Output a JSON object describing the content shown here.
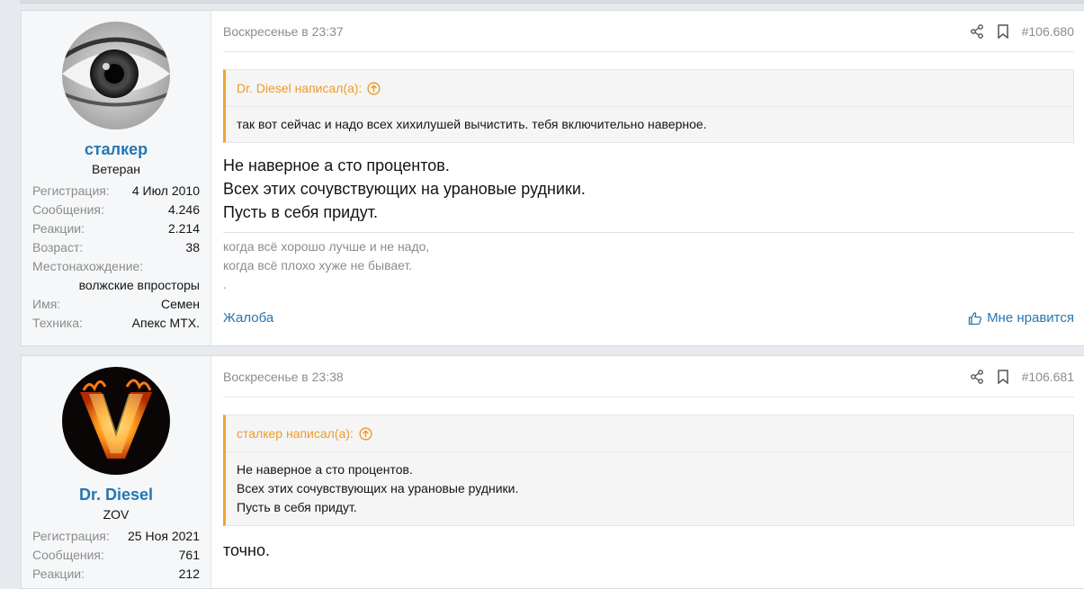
{
  "posts": [
    {
      "user": {
        "name": "сталкер",
        "title": "Ветеран",
        "avatar": "eye-avatar"
      },
      "stats": {
        "reg_label": "Регистрация:",
        "reg": "4 Июл 2010",
        "msg_label": "Сообщения:",
        "msgs": "4.246",
        "react_label": "Реакции:",
        "reacts": "2.214",
        "age_label": "Возраст:",
        "age": "38",
        "loc_label": "Местонахождение:",
        "loc": "волжские впросторы",
        "name_label": "Имя:",
        "real_name": "Семен",
        "tech_label": "Техника:",
        "tech": "Апекс МТХ."
      },
      "time": "Воскресенье в 23:37",
      "number": "#106.680",
      "quote": {
        "author": "Dr. Diesel написал(а):",
        "lines": [
          "так вот сейчас и надо всех хихилушей вычистить. тебя включительно наверное."
        ]
      },
      "message": [
        "Не наверное а сто процентов.",
        "Всех этих сочувствующих на урановые рудники.",
        "Пусть в себя придут."
      ],
      "signature": [
        "когда всё хорошо лучше и не надо,",
        "когда всё плохо хуже не бывает.",
        "."
      ],
      "report": "Жалоба",
      "like": "Мне нравится"
    },
    {
      "user": {
        "name": "Dr. Diesel",
        "title": "ZOV",
        "avatar": "flaming-v-avatar"
      },
      "stats": {
        "reg_label": "Регистрация:",
        "reg": "25 Ноя 2021",
        "msg_label": "Сообщения:",
        "msgs": "761",
        "react_label": "Реакции:",
        "reacts": "212"
      },
      "time": "Воскресенье в 23:38",
      "number": "#106.681",
      "quote": {
        "author": "сталкер написал(а):",
        "lines": [
          "Не наверное а сто процентов.",
          "Всех этих сочувствующих на урановые рудники.",
          "Пусть в себя придут."
        ]
      },
      "message": [
        "точно."
      ]
    }
  ],
  "colors": {
    "link": "#2577b1",
    "quote_accent": "#f0a531",
    "muted": "#8c8c8c"
  },
  "icons": [
    "share-icon",
    "bookmark-icon",
    "arrow-up-circle-icon",
    "thumbs-up-icon"
  ]
}
